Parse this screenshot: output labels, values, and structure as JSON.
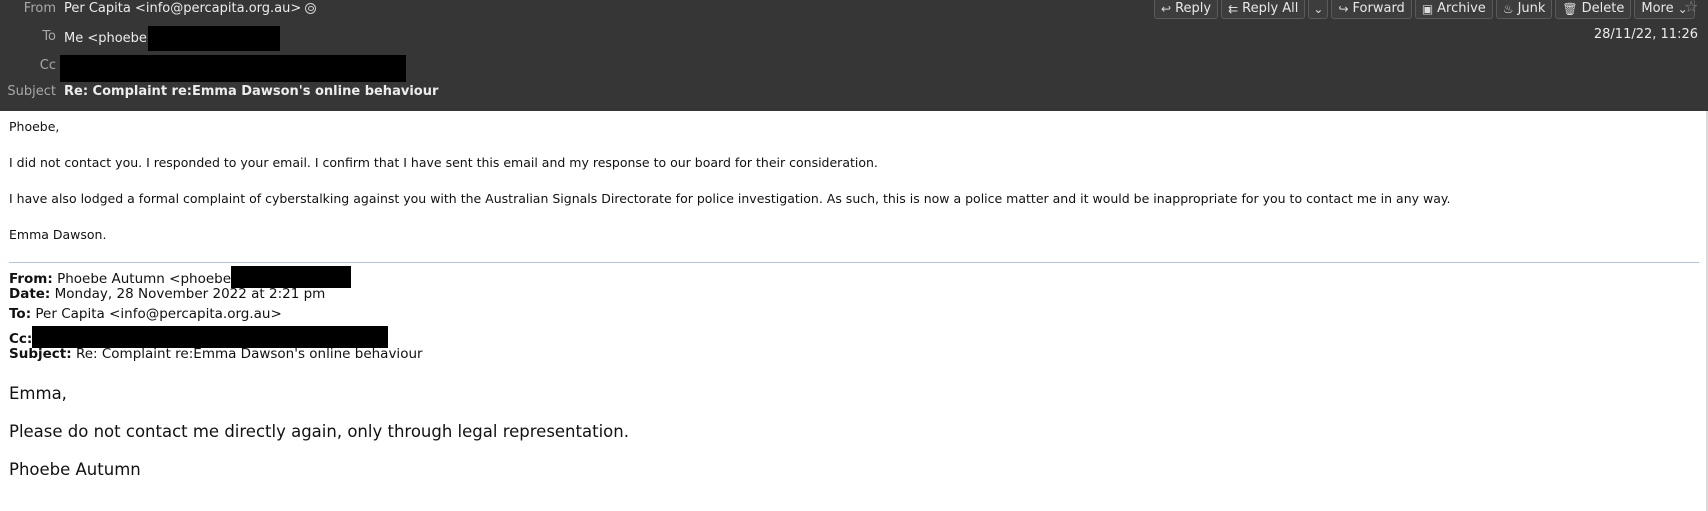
{
  "header": {
    "from_label": "From",
    "from_value": "Per Capita <info@percapita.org.au>",
    "to_label": "To",
    "to_value": "Me <phoebe",
    "cc_label": "Cc",
    "subject_label": "Subject",
    "subject_value": "Re: Complaint re:Emma Dawson's online behaviour",
    "date": "28/11/22, 11:26"
  },
  "toolbar": {
    "reply": "Reply",
    "reply_all": "Reply All",
    "forward": "Forward",
    "archive": "Archive",
    "junk": "Junk",
    "delete": "Delete",
    "more": "More"
  },
  "body": {
    "greeting": "Phoebe,",
    "para1": "I did not contact you. I responded to your email. I confirm that I have sent this email and my response to our board for their consideration.",
    "para2": "I have also lodged a formal complaint of cyberstalking against you with the Australian Signals Directorate for police investigation. As such, this is now a police matter and it would be inappropriate for you to contact me in any way.",
    "signoff": "Emma Dawson."
  },
  "quoted": {
    "from_label": "From:",
    "from_value": "Phoebe Autumn <phoebe",
    "date_label": "Date:",
    "date_value": "Monday, 28 November 2022 at 2:21 pm",
    "to_label": "To:",
    "to_value": "Per Capita <info@percapita.org.au>",
    "cc_label": "Cc:",
    "subject_label": "Subject:",
    "subject_value": "Re: Complaint re:Emma Dawson's online behaviour",
    "greeting": "Emma,",
    "para1": "Please do not contact me directly again, only through legal representation.",
    "signoff": "Phoebe Autumn"
  },
  "colors": {
    "header_bg": "#363636",
    "redaction": "#000000",
    "divider": "#b5c6d6"
  },
  "icons": [
    "contact-icon",
    "reply-icon",
    "reply-all-icon",
    "chevron-down-icon",
    "forward-icon",
    "archive-icon",
    "junk-icon",
    "delete-icon",
    "star-icon"
  ]
}
